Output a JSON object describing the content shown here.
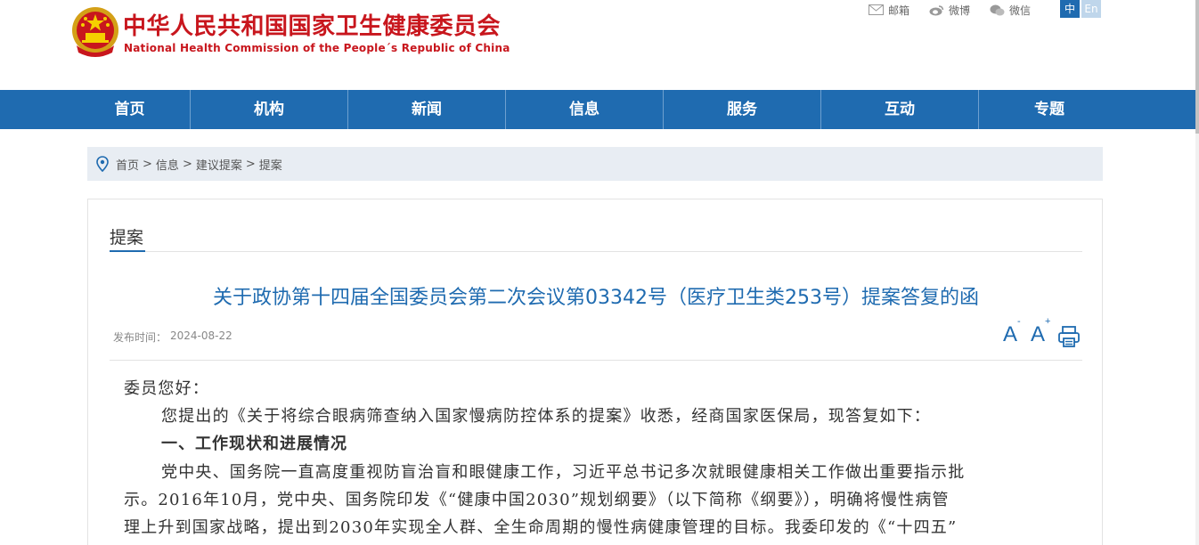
{
  "header": {
    "title_cn": "中华人民共和国国家卫生健康委员会",
    "title_en": "National Health Commission of the People´s Republic of China",
    "links": [
      {
        "label": "邮箱",
        "icon": "mail-icon"
      },
      {
        "label": "微博",
        "icon": "weibo-icon"
      },
      {
        "label": "微信",
        "icon": "wechat-icon"
      }
    ],
    "lang_zh": "中",
    "lang_en": "En"
  },
  "nav": {
    "items": [
      "首页",
      "机构",
      "新闻",
      "信息",
      "服务",
      "互动",
      "专题"
    ]
  },
  "breadcrumb": {
    "items": [
      "首页",
      "信息",
      "建议提案",
      "提案"
    ],
    "separator": ">"
  },
  "section": {
    "tab": "提案"
  },
  "article": {
    "title": "关于政协第十四届全国委员会第二次会议第03342号（医疗卫生类253号）提案答复的函",
    "pubdate_label": "发布时间：",
    "pubdate": "2024-08-22",
    "font_decrease": "A",
    "font_decrease_mark": "-",
    "font_increase": "A",
    "font_increase_mark": "+",
    "paragraphs": [
      "委员您好：",
      "您提出的《关于将综合眼病筛查纳入国家慢病防控体系的提案》收悉，经商国家医保局，现答复如下：",
      "一、工作现状和进展情况",
      "党中央、国务院一直高度重视防盲治盲和眼健康工作，习近平总书记多次就眼健康相关工作做出重要指示批",
      "示。2016年10月，党中央、国务院印发《“健康中国2030”规划纲要》（以下简称《纲要》），明确将慢性病管",
      "理上升到国家战略，提出到2030年实现全人群、全生命周期的慢性病健康管理的目标。我委印发的《“十四五”"
    ]
  },
  "colors": {
    "brand_red": "#c8161d",
    "nav_blue": "#1f6bb0"
  }
}
